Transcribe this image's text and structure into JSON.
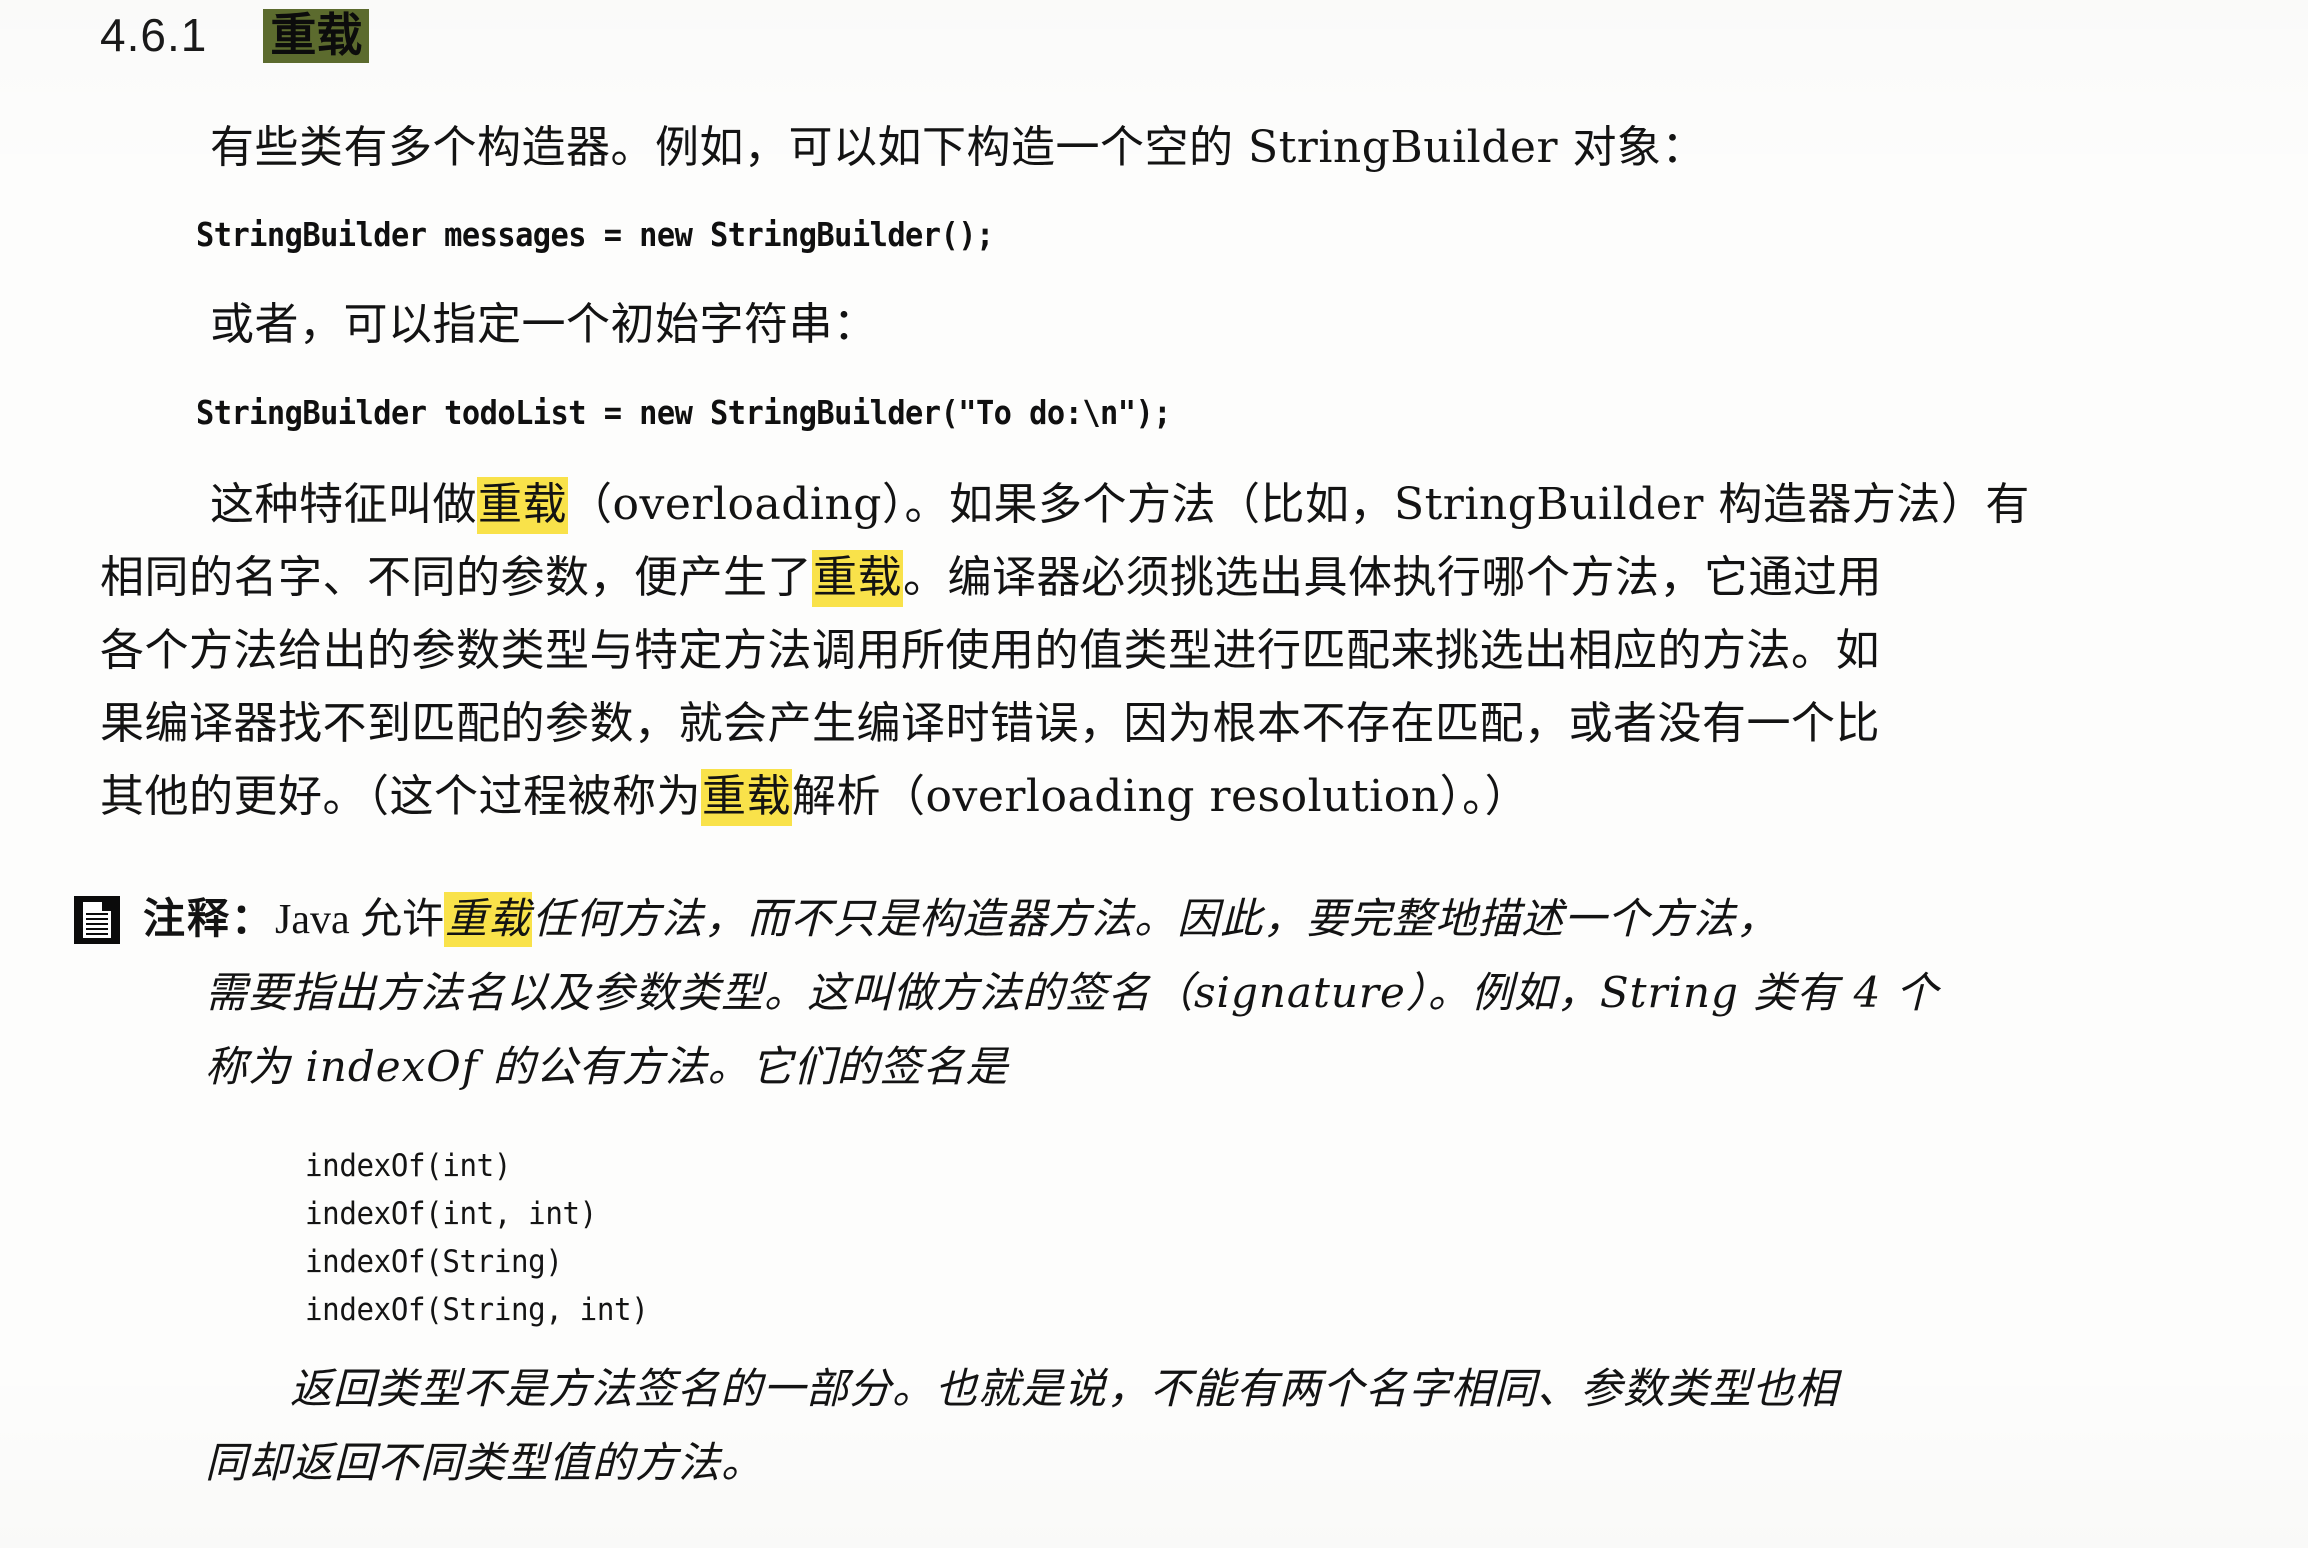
{
  "page": {
    "background_color": "#fdfdfc",
    "text_color": "#131313"
  },
  "colors": {
    "highlight_yellow": "#f9e24a",
    "highlight_green": "#5c6b2e",
    "note_icon_bg": "#0b0b0b"
  },
  "heading": {
    "number": "4.6.1",
    "title": "重载"
  },
  "intro": {
    "line1": "有些类有多个构造器。例如，可以如下构造一个空的 StringBuilder 对象："
  },
  "code1": {
    "line1": "StringBuilder messages = new StringBuilder();"
  },
  "intro2": {
    "line1": "或者，可以指定一个初始字符串："
  },
  "code2": {
    "line1": "StringBuilder todoList = new StringBuilder(\"To do:\\n\");"
  },
  "paragraph_overloading": {
    "l1_a": "这种特征叫做",
    "l1_hl": "重载",
    "l1_b": "（overloading）。如果多个方法（比如，StringBuilder 构造器方法）有",
    "l2_a": "相同的名字、不同的参数，便产生了",
    "l2_hl": "重载",
    "l2_b": "。编译器必须挑选出具体执行哪个方法，它通过用",
    "l3": "各个方法给出的参数类型与特定方法调用所使用的值类型进行匹配来挑选出相应的方法。如",
    "l4": "果编译器找不到匹配的参数，就会产生编译时错误，因为根本不存在匹配，或者没有一个比",
    "l5_a": "其他的更好。（这个过程被称为",
    "l5_hl": "重载",
    "l5_b": "解析（overloading resolution）。）"
  },
  "note": {
    "icon": "note-document-icon",
    "label": "注释：",
    "l1_a": "Java 允许",
    "l1_hl": "重载",
    "l1_b": "任何方法，而不只是构造器方法。因此，要完整地描述一个方法，",
    "l2": "需要指出方法名以及参数类型。这叫做方法的签名（signature）。例如，String 类有 4 个",
    "l3": "称为 indexOf 的公有方法。它们的签名是",
    "code": [
      "indexOf(int)",
      "indexOf(int, int)",
      "indexOf(String)",
      "indexOf(String, int)"
    ],
    "l4": "返回类型不是方法签名的一部分。也就是说，不能有两个名字相同、参数类型也相",
    "l5": "同却返回不同类型值的方法。"
  }
}
